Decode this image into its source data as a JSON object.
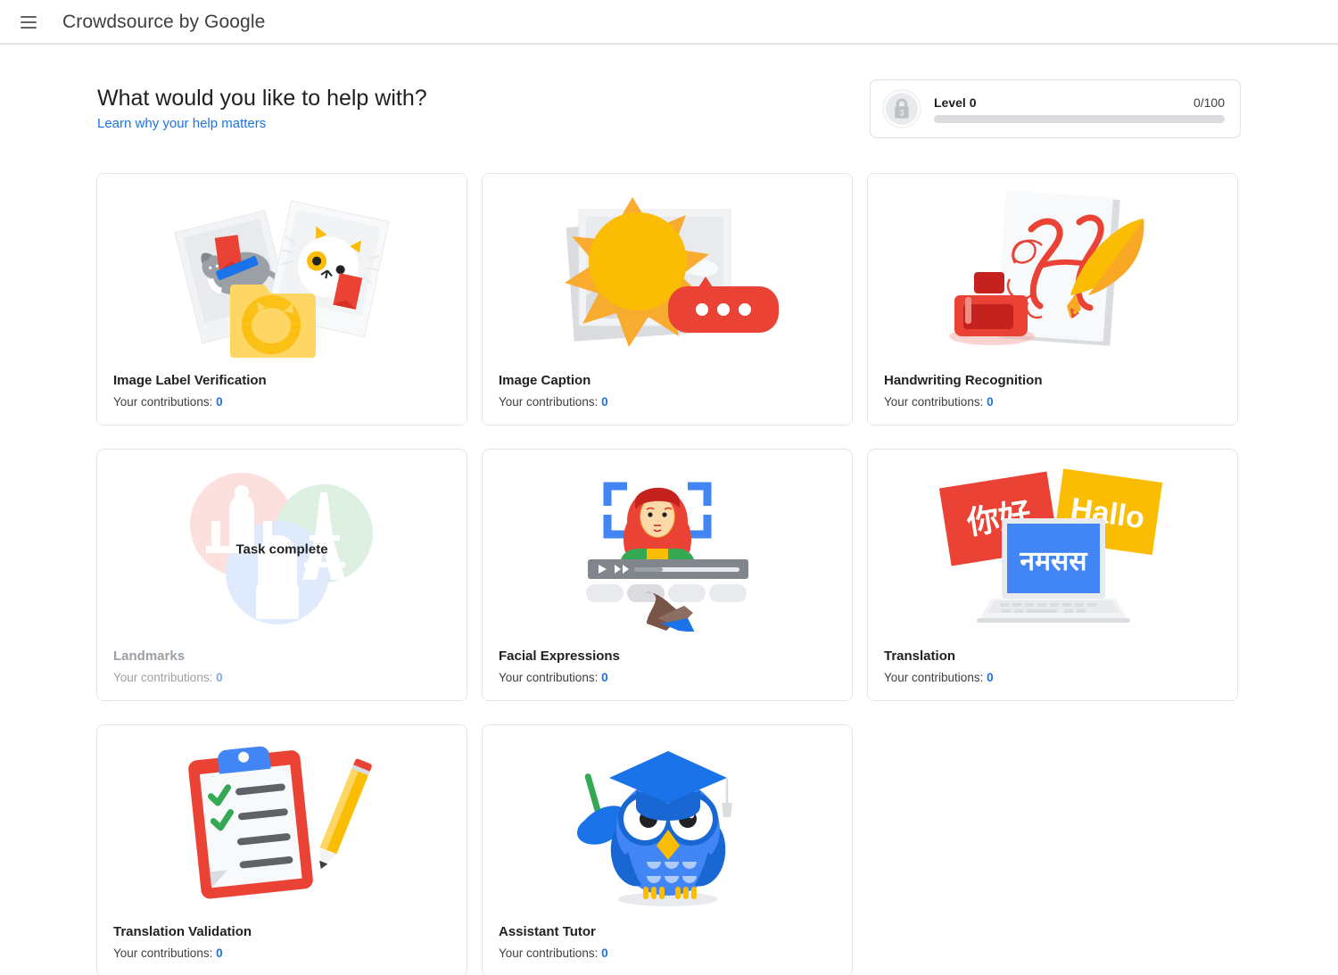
{
  "appbar": {
    "menu_icon": "hamburger-menu-icon",
    "title": "Crowdsource by Google"
  },
  "header": {
    "title": "What would you like to help with?",
    "learn_link": "Learn why your help matters"
  },
  "level": {
    "badge_icon": "lock-icon",
    "badge_number": "3",
    "name": "Level 0",
    "progress_text": "0/100",
    "progress_percent": 0,
    "bar_track_color": "#dadce0",
    "bar_fill_color": "#1a73e8"
  },
  "labels": {
    "contributions_prefix": "Your contributions: ",
    "task_complete": "Task complete"
  },
  "colors": {
    "link": "#1a73e8",
    "title": "#202124",
    "disabled": "#9aa0a6",
    "card_border": "#e6e6e6"
  },
  "cards": [
    {
      "id": "image-label-verification",
      "name": "Image Label Verification",
      "contributions": "0",
      "art": "cat-photos-folder-illustration",
      "disabled": false
    },
    {
      "id": "image-caption",
      "name": "Image Caption",
      "contributions": "0",
      "art": "sun-photo-speech-bubble-illustration",
      "disabled": false
    },
    {
      "id": "handwriting-recognition",
      "name": "Handwriting Recognition",
      "contributions": "0",
      "art": "inkwell-quill-calligraphy-illustration",
      "disabled": false
    },
    {
      "id": "landmarks",
      "name": "Landmarks",
      "contributions": "0",
      "art": "landmark-circles-illustration",
      "disabled": true,
      "overlay": "Task complete"
    },
    {
      "id": "facial-expressions",
      "name": "Facial Expressions",
      "contributions": "0",
      "art": "face-detection-video-illustration",
      "disabled": false
    },
    {
      "id": "translation",
      "name": "Translation",
      "contributions": "0",
      "art": "laptop-language-cards-illustration",
      "disabled": false,
      "art_text": {
        "red_card": "你好",
        "yellow_card": "Hallo",
        "laptop_screen": "नमसस"
      }
    },
    {
      "id": "translation-validation",
      "name": "Translation Validation",
      "contributions": "0",
      "art": "clipboard-checklist-pencil-illustration",
      "disabled": false
    },
    {
      "id": "assistant-tutor",
      "name": "Assistant Tutor",
      "contributions": "0",
      "art": "graduate-owl-illustration",
      "disabled": false
    }
  ]
}
